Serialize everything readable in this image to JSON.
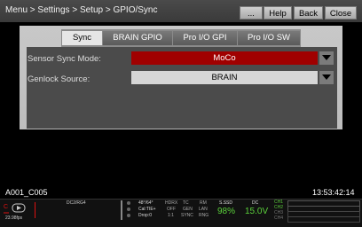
{
  "topbar": {
    "breadcrumb": "Menu > Settings > Setup > GPIO/Sync",
    "more_label": "...",
    "help_label": "Help",
    "back_label": "Back",
    "close_label": "Close"
  },
  "tabs": [
    {
      "label": "Sync",
      "active": true
    },
    {
      "label": "BRAIN GPIO",
      "active": false
    },
    {
      "label": "Pro I/O GPI",
      "active": false
    },
    {
      "label": "Pro I/O SW",
      "active": false
    }
  ],
  "settings": {
    "sync_mode_label": "Sensor Sync Mode:",
    "sync_mode_value": "MoCo",
    "genlock_label": "Genlock Source:",
    "genlock_value": "BRAIN",
    "accent_color": "#a00000"
  },
  "status": {
    "clip_name": "A001_C005",
    "timecode": "13:53:42:14",
    "fps": "23.98fps",
    "codec": "DC2/RG4",
    "exposure": "48°/64°",
    "cal": "Cal:TIE+",
    "drop": "Drop:0",
    "tc_labels": [
      "HDRX",
      "TC",
      "RM"
    ],
    "tc_row2": [
      "OFF",
      "GEN",
      "LAN"
    ],
    "tc_row3": [
      "1:1",
      "SYNC",
      "RNG"
    ],
    "media_label": "S.SSD",
    "media_value": "98%",
    "power_label": "DC",
    "power_value": "15.0V",
    "channels": [
      "CH1",
      "CH2",
      "CH3",
      "CH4"
    ]
  }
}
